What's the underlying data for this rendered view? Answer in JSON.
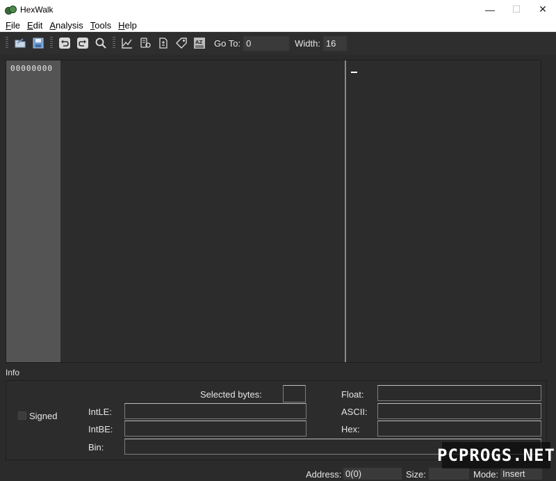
{
  "window": {
    "title": "HexWalk",
    "controls": {
      "minimize": "—",
      "maximize": "☐",
      "close": "✕"
    }
  },
  "menu": {
    "items": [
      {
        "first": "F",
        "rest": "ile"
      },
      {
        "first": "E",
        "rest": "dit"
      },
      {
        "first": "A",
        "rest": "nalysis"
      },
      {
        "first": "T",
        "rest": "ools"
      },
      {
        "first": "H",
        "rest": "elp"
      }
    ]
  },
  "toolbar": {
    "icons": [
      "open-folder-icon",
      "save-icon",
      "undo-icon",
      "redo-icon",
      "search-icon",
      "chart-icon",
      "byte-pattern-icon",
      "file-compare-icon",
      "tag-icon",
      "sort-az-icon"
    ],
    "goto_label": "Go To:",
    "goto_value": "0",
    "width_label": "Width:",
    "width_value": "16"
  },
  "hex_view": {
    "offset": "00000000"
  },
  "info": {
    "title": "Info",
    "signed_label": "Signed",
    "selected_bytes_label": "Selected bytes:",
    "selected_bytes_value": "",
    "intle_label": "IntLE:",
    "intbe_label": "IntBE:",
    "bin_label": "Bin:",
    "float_label": "Float:",
    "ascii_label": "ASCII:",
    "hex_label": "Hex:"
  },
  "status": {
    "address_label": "Address:",
    "address_value": "0(0)",
    "size_label": "Size:",
    "size_value": "",
    "mode_label": "Mode:",
    "mode_value": "Insert"
  },
  "watermark": "PCPROGS.NET",
  "colors": {
    "background": "#2b2b2b",
    "offset_column": "#545454",
    "text": "#e6e6e6"
  }
}
